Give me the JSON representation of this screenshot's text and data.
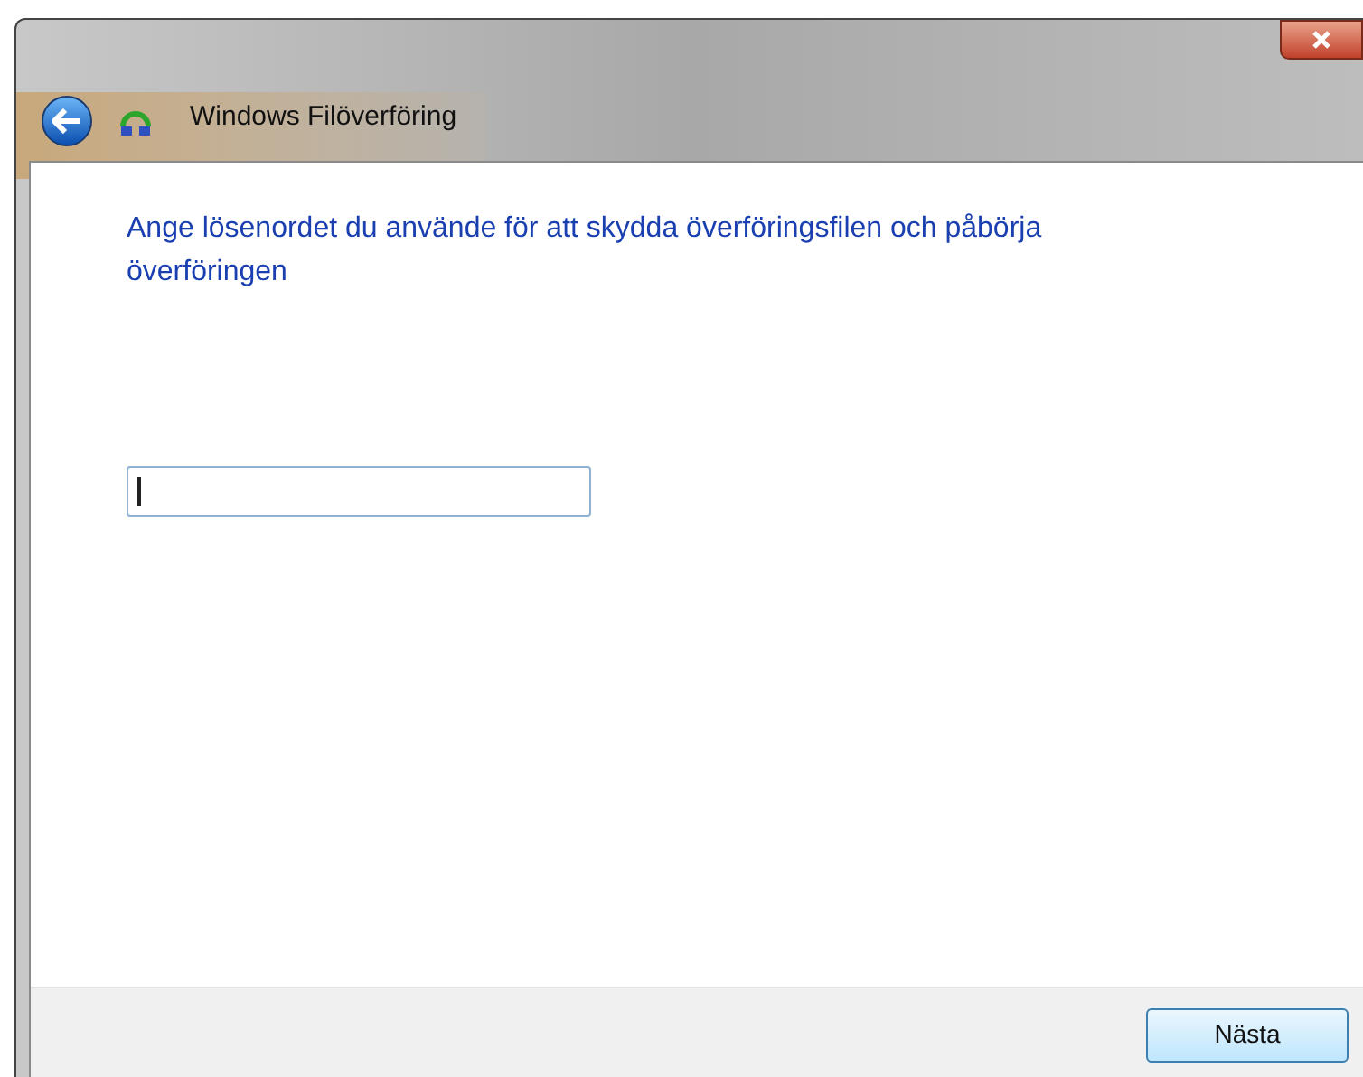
{
  "window": {
    "title": "Windows Filöverföring"
  },
  "heading": "Ange lösenordet du använde för att skydda överföringsfilen och påbörja överföringen",
  "password_field": {
    "focused": true
  },
  "buttons": [
    {
      "label": "Nästa"
    }
  ]
}
